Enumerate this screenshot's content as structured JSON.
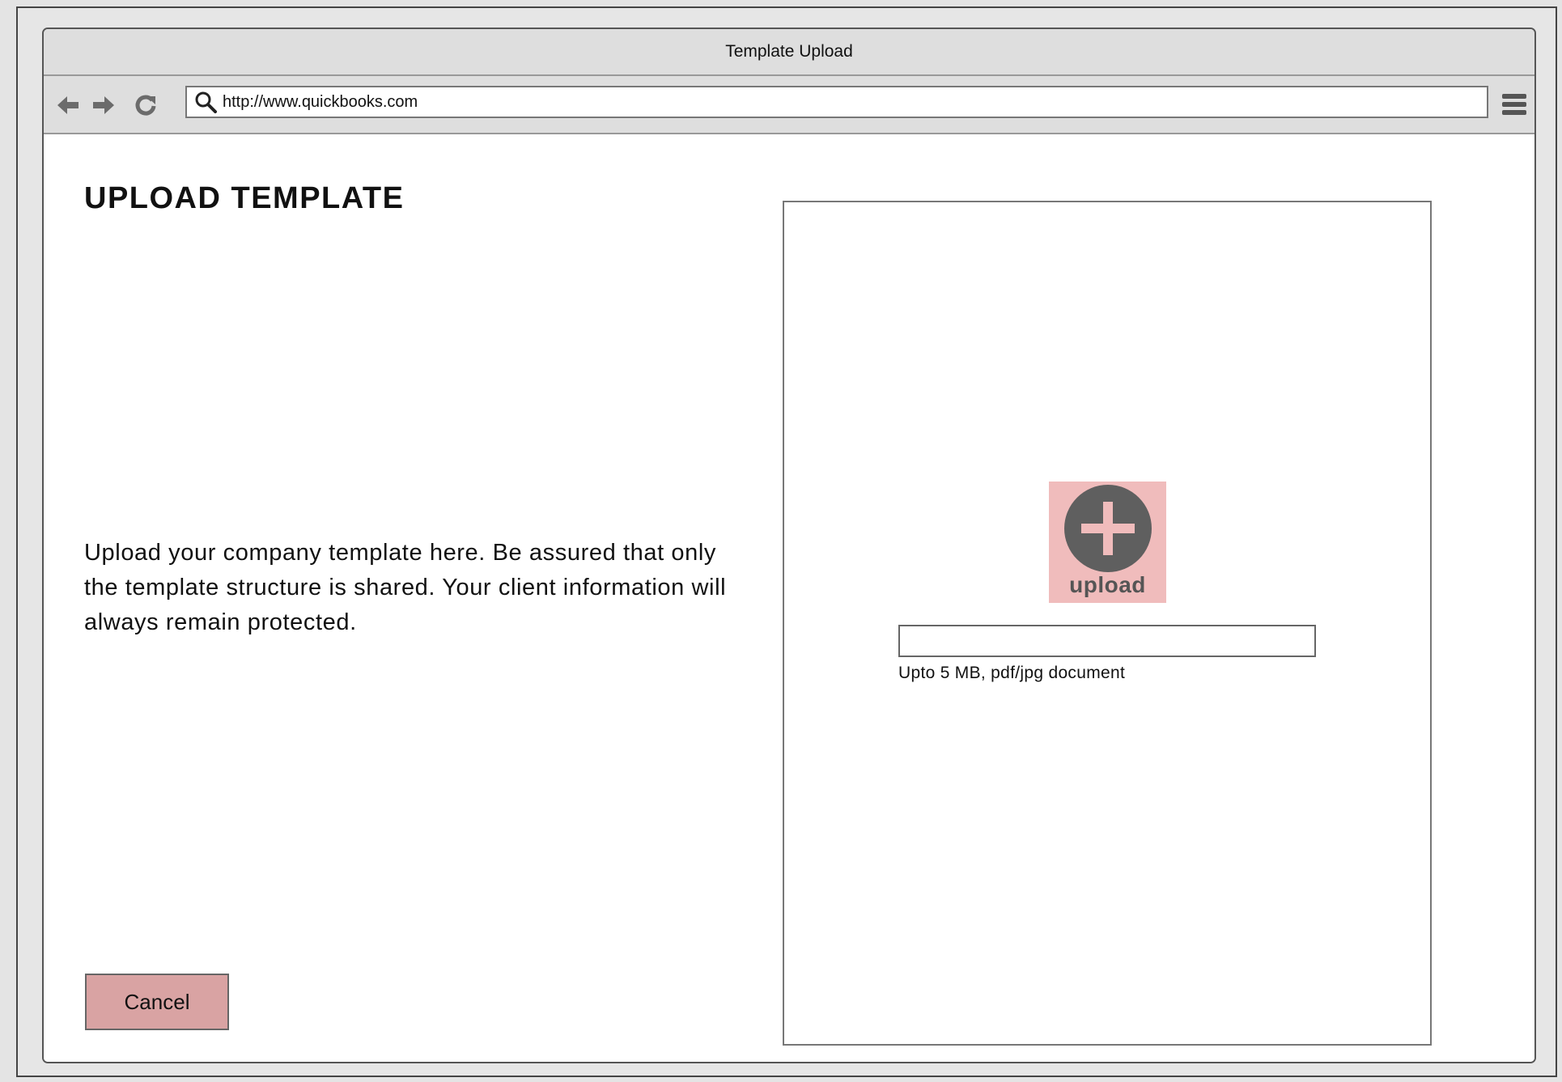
{
  "window": {
    "title": "Template Upload"
  },
  "navigation": {
    "url": "http://www.quickbooks.com",
    "icons": [
      "back-arrow-icon",
      "forward-arrow-icon",
      "refresh-icon",
      "search-icon",
      "hamburger-menu-icon"
    ]
  },
  "main": {
    "title": "UPLOAD TEMPLATE",
    "description": "Upload your company template here. Be assured that only the template structure is shared. Your client information will always remain protected.",
    "cancel_label": "Cancel"
  },
  "upload": {
    "button_label": "upload",
    "file_value": "",
    "hint": "Upto 5 MB, pdf/jpg document"
  },
  "colors": {
    "cancel_button": "#d9a3a3",
    "upload_button_bg": "#f0bcbc",
    "upload_icon": "#5f5f5f"
  }
}
